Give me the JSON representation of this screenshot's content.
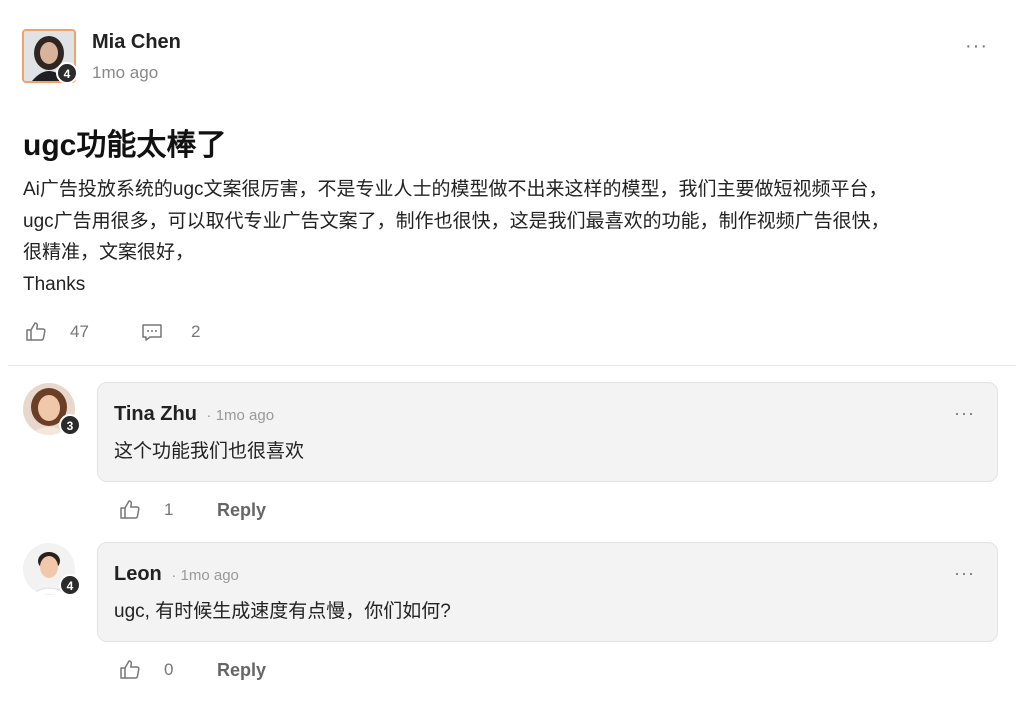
{
  "post": {
    "author": "Mia Chen",
    "level": "4",
    "time": "1mo ago",
    "title": "ugc功能太棒了",
    "body_lines": [
      "Ai广告投放系统的ugc文案很厉害，不是专业人士的模型做不出来这样的模型，我们主要做短视频平台，",
      "ugc广告用很多，可以取代专业广告文案了，制作也很快，这是我们最喜欢的功能，制作视频广告很快，",
      "很精准，文案很好，",
      "Thanks"
    ],
    "likes": "47",
    "comments": "2",
    "more": "···"
  },
  "comments": [
    {
      "author": "Tina Zhu",
      "level": "3",
      "time": "1mo ago",
      "text": "这个功能我们也很喜欢",
      "likes": "1",
      "reply": "Reply",
      "more": "···"
    },
    {
      "author": "Leon",
      "level": "4",
      "time": "1mo ago",
      "text": "ugc, 有时候生成速度有点慢，你们如何?",
      "likes": "0",
      "reply": "Reply",
      "more": "···"
    }
  ],
  "separator": "·",
  "icons": {
    "like": "thumbs-up-icon",
    "comment": "comment-icon",
    "more": "more-horizontal-icon"
  }
}
